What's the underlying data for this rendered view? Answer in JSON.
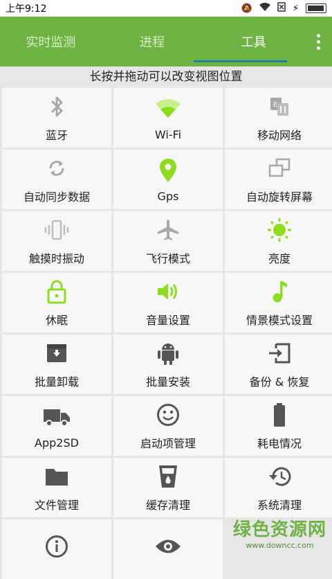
{
  "status": {
    "time": "上午9:12"
  },
  "tabs": [
    {
      "label": "实时监测"
    },
    {
      "label": "进程"
    },
    {
      "label": "工具"
    }
  ],
  "hint": "长按并拖动可以改变视图位置",
  "tiles": [
    {
      "label": "蓝牙",
      "icon": "bluetooth-icon"
    },
    {
      "label": "Wi-Fi",
      "icon": "wifi-icon"
    },
    {
      "label": "移动网络",
      "icon": "mobile-network-icon"
    },
    {
      "label": "自动同步数据",
      "icon": "sync-icon"
    },
    {
      "label": "Gps",
      "icon": "location-pin-icon"
    },
    {
      "label": "自动旋转屏幕",
      "icon": "rotate-screen-icon"
    },
    {
      "label": "触摸时振动",
      "icon": "vibrate-icon"
    },
    {
      "label": "飞行模式",
      "icon": "airplane-icon"
    },
    {
      "label": "亮度",
      "icon": "brightness-icon"
    },
    {
      "label": "休眠",
      "icon": "lock-icon"
    },
    {
      "label": "音量设置",
      "icon": "volume-icon"
    },
    {
      "label": "情景模式设置",
      "icon": "music-note-icon"
    },
    {
      "label": "批量卸载",
      "icon": "uninstall-box-icon"
    },
    {
      "label": "批量安装",
      "icon": "android-icon"
    },
    {
      "label": "备份 & 恢复",
      "icon": "backup-restore-icon"
    },
    {
      "label": "App2SD",
      "icon": "truck-icon"
    },
    {
      "label": "启动项管理",
      "icon": "smiley-icon"
    },
    {
      "label": "耗电情况",
      "icon": "battery-icon"
    },
    {
      "label": "文件管理",
      "icon": "folder-icon"
    },
    {
      "label": "缓存清理",
      "icon": "cup-icon"
    },
    {
      "label": "系统清理",
      "icon": "history-icon"
    },
    {
      "label": "",
      "icon": "info-icon"
    },
    {
      "label": "",
      "icon": "eye-icon"
    }
  ],
  "watermark": {
    "main": "绿色资源网",
    "sub": "www.downcc.com"
  },
  "colors": {
    "accent": "#6fb345",
    "active_icon": "#8fdc1e",
    "inactive_icon": "#a8a8a8",
    "dark_icon": "#555555"
  }
}
